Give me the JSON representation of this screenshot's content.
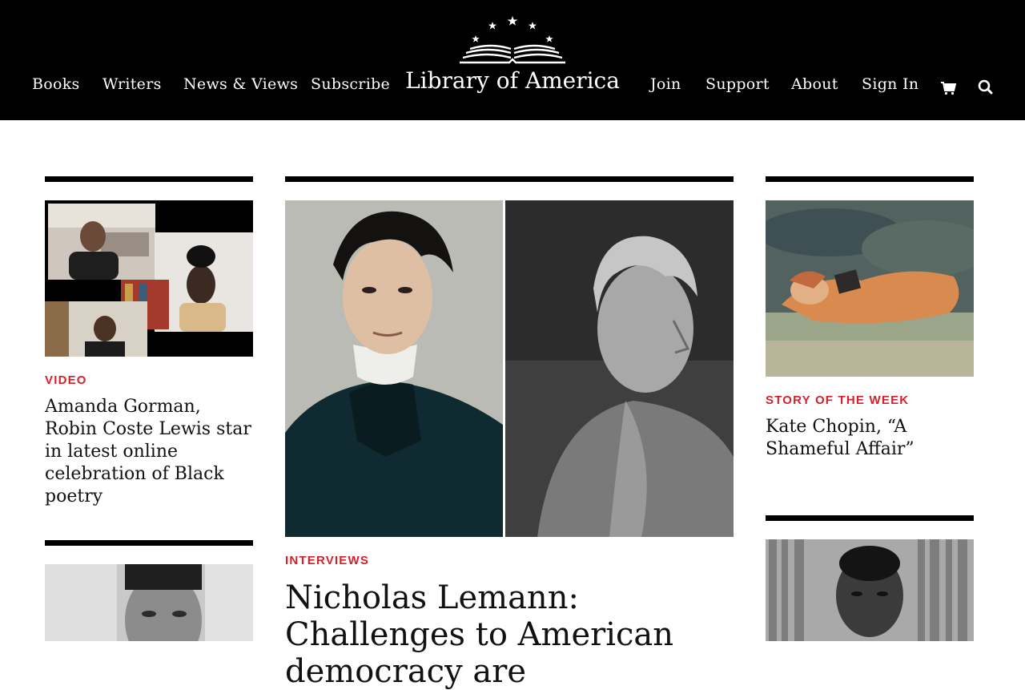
{
  "header": {
    "logo_text": "Library of America",
    "nav_left": [
      "Books",
      "Writers",
      "News & Views",
      "Subscribe"
    ],
    "nav_right": [
      "Join",
      "Support",
      "About",
      "Sign In"
    ],
    "cart_icon": "cart-icon",
    "search_icon": "search-icon"
  },
  "left_column": {
    "card1": {
      "label": "VIDEO",
      "headline": "Amanda Gorman, Robin Coste Lewis star in latest online celebration of Black poetry",
      "image": "video-call-grid-image"
    },
    "card2": {
      "image": "portrait-man-black-white-image"
    }
  },
  "center_column": {
    "feature": {
      "label": "INTERVIEWS",
      "headline": "Nicholas Lemann: Challenges to American democracy are",
      "image_left": "tocqueville-portrait-image",
      "image_right": "jane-addams-portrait-image"
    }
  },
  "right_column": {
    "card1": {
      "label": "STORY OF THE WEEK",
      "headline": "Kate Chopin, “A Shameful Affair”",
      "image": "woman-reading-in-grass-painting-image"
    },
    "card2": {
      "image": "portrait-man-bookshelf-image"
    }
  },
  "colors": {
    "header_bg": "#000000",
    "accent_red": "#d6202b",
    "rule": "#000000"
  }
}
